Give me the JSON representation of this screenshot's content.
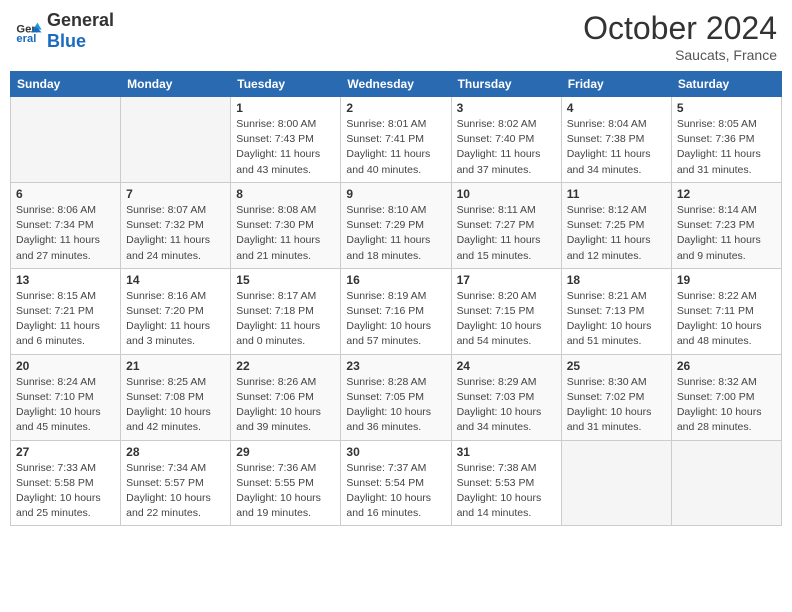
{
  "header": {
    "logo_line1": "General",
    "logo_line2": "Blue",
    "month": "October 2024",
    "location": "Saucats, France"
  },
  "weekdays": [
    "Sunday",
    "Monday",
    "Tuesday",
    "Wednesday",
    "Thursday",
    "Friday",
    "Saturday"
  ],
  "weeks": [
    [
      {
        "day": null
      },
      {
        "day": null
      },
      {
        "day": "1",
        "sunrise": "Sunrise: 8:00 AM",
        "sunset": "Sunset: 7:43 PM",
        "daylight": "Daylight: 11 hours and 43 minutes."
      },
      {
        "day": "2",
        "sunrise": "Sunrise: 8:01 AM",
        "sunset": "Sunset: 7:41 PM",
        "daylight": "Daylight: 11 hours and 40 minutes."
      },
      {
        "day": "3",
        "sunrise": "Sunrise: 8:02 AM",
        "sunset": "Sunset: 7:40 PM",
        "daylight": "Daylight: 11 hours and 37 minutes."
      },
      {
        "day": "4",
        "sunrise": "Sunrise: 8:04 AM",
        "sunset": "Sunset: 7:38 PM",
        "daylight": "Daylight: 11 hours and 34 minutes."
      },
      {
        "day": "5",
        "sunrise": "Sunrise: 8:05 AM",
        "sunset": "Sunset: 7:36 PM",
        "daylight": "Daylight: 11 hours and 31 minutes."
      }
    ],
    [
      {
        "day": "6",
        "sunrise": "Sunrise: 8:06 AM",
        "sunset": "Sunset: 7:34 PM",
        "daylight": "Daylight: 11 hours and 27 minutes."
      },
      {
        "day": "7",
        "sunrise": "Sunrise: 8:07 AM",
        "sunset": "Sunset: 7:32 PM",
        "daylight": "Daylight: 11 hours and 24 minutes."
      },
      {
        "day": "8",
        "sunrise": "Sunrise: 8:08 AM",
        "sunset": "Sunset: 7:30 PM",
        "daylight": "Daylight: 11 hours and 21 minutes."
      },
      {
        "day": "9",
        "sunrise": "Sunrise: 8:10 AM",
        "sunset": "Sunset: 7:29 PM",
        "daylight": "Daylight: 11 hours and 18 minutes."
      },
      {
        "day": "10",
        "sunrise": "Sunrise: 8:11 AM",
        "sunset": "Sunset: 7:27 PM",
        "daylight": "Daylight: 11 hours and 15 minutes."
      },
      {
        "day": "11",
        "sunrise": "Sunrise: 8:12 AM",
        "sunset": "Sunset: 7:25 PM",
        "daylight": "Daylight: 11 hours and 12 minutes."
      },
      {
        "day": "12",
        "sunrise": "Sunrise: 8:14 AM",
        "sunset": "Sunset: 7:23 PM",
        "daylight": "Daylight: 11 hours and 9 minutes."
      }
    ],
    [
      {
        "day": "13",
        "sunrise": "Sunrise: 8:15 AM",
        "sunset": "Sunset: 7:21 PM",
        "daylight": "Daylight: 11 hours and 6 minutes."
      },
      {
        "day": "14",
        "sunrise": "Sunrise: 8:16 AM",
        "sunset": "Sunset: 7:20 PM",
        "daylight": "Daylight: 11 hours and 3 minutes."
      },
      {
        "day": "15",
        "sunrise": "Sunrise: 8:17 AM",
        "sunset": "Sunset: 7:18 PM",
        "daylight": "Daylight: 11 hours and 0 minutes."
      },
      {
        "day": "16",
        "sunrise": "Sunrise: 8:19 AM",
        "sunset": "Sunset: 7:16 PM",
        "daylight": "Daylight: 10 hours and 57 minutes."
      },
      {
        "day": "17",
        "sunrise": "Sunrise: 8:20 AM",
        "sunset": "Sunset: 7:15 PM",
        "daylight": "Daylight: 10 hours and 54 minutes."
      },
      {
        "day": "18",
        "sunrise": "Sunrise: 8:21 AM",
        "sunset": "Sunset: 7:13 PM",
        "daylight": "Daylight: 10 hours and 51 minutes."
      },
      {
        "day": "19",
        "sunrise": "Sunrise: 8:22 AM",
        "sunset": "Sunset: 7:11 PM",
        "daylight": "Daylight: 10 hours and 48 minutes."
      }
    ],
    [
      {
        "day": "20",
        "sunrise": "Sunrise: 8:24 AM",
        "sunset": "Sunset: 7:10 PM",
        "daylight": "Daylight: 10 hours and 45 minutes."
      },
      {
        "day": "21",
        "sunrise": "Sunrise: 8:25 AM",
        "sunset": "Sunset: 7:08 PM",
        "daylight": "Daylight: 10 hours and 42 minutes."
      },
      {
        "day": "22",
        "sunrise": "Sunrise: 8:26 AM",
        "sunset": "Sunset: 7:06 PM",
        "daylight": "Daylight: 10 hours and 39 minutes."
      },
      {
        "day": "23",
        "sunrise": "Sunrise: 8:28 AM",
        "sunset": "Sunset: 7:05 PM",
        "daylight": "Daylight: 10 hours and 36 minutes."
      },
      {
        "day": "24",
        "sunrise": "Sunrise: 8:29 AM",
        "sunset": "Sunset: 7:03 PM",
        "daylight": "Daylight: 10 hours and 34 minutes."
      },
      {
        "day": "25",
        "sunrise": "Sunrise: 8:30 AM",
        "sunset": "Sunset: 7:02 PM",
        "daylight": "Daylight: 10 hours and 31 minutes."
      },
      {
        "day": "26",
        "sunrise": "Sunrise: 8:32 AM",
        "sunset": "Sunset: 7:00 PM",
        "daylight": "Daylight: 10 hours and 28 minutes."
      }
    ],
    [
      {
        "day": "27",
        "sunrise": "Sunrise: 7:33 AM",
        "sunset": "Sunset: 5:58 PM",
        "daylight": "Daylight: 10 hours and 25 minutes."
      },
      {
        "day": "28",
        "sunrise": "Sunrise: 7:34 AM",
        "sunset": "Sunset: 5:57 PM",
        "daylight": "Daylight: 10 hours and 22 minutes."
      },
      {
        "day": "29",
        "sunrise": "Sunrise: 7:36 AM",
        "sunset": "Sunset: 5:55 PM",
        "daylight": "Daylight: 10 hours and 19 minutes."
      },
      {
        "day": "30",
        "sunrise": "Sunrise: 7:37 AM",
        "sunset": "Sunset: 5:54 PM",
        "daylight": "Daylight: 10 hours and 16 minutes."
      },
      {
        "day": "31",
        "sunrise": "Sunrise: 7:38 AM",
        "sunset": "Sunset: 5:53 PM",
        "daylight": "Daylight: 10 hours and 14 minutes."
      },
      {
        "day": null
      },
      {
        "day": null
      }
    ]
  ]
}
